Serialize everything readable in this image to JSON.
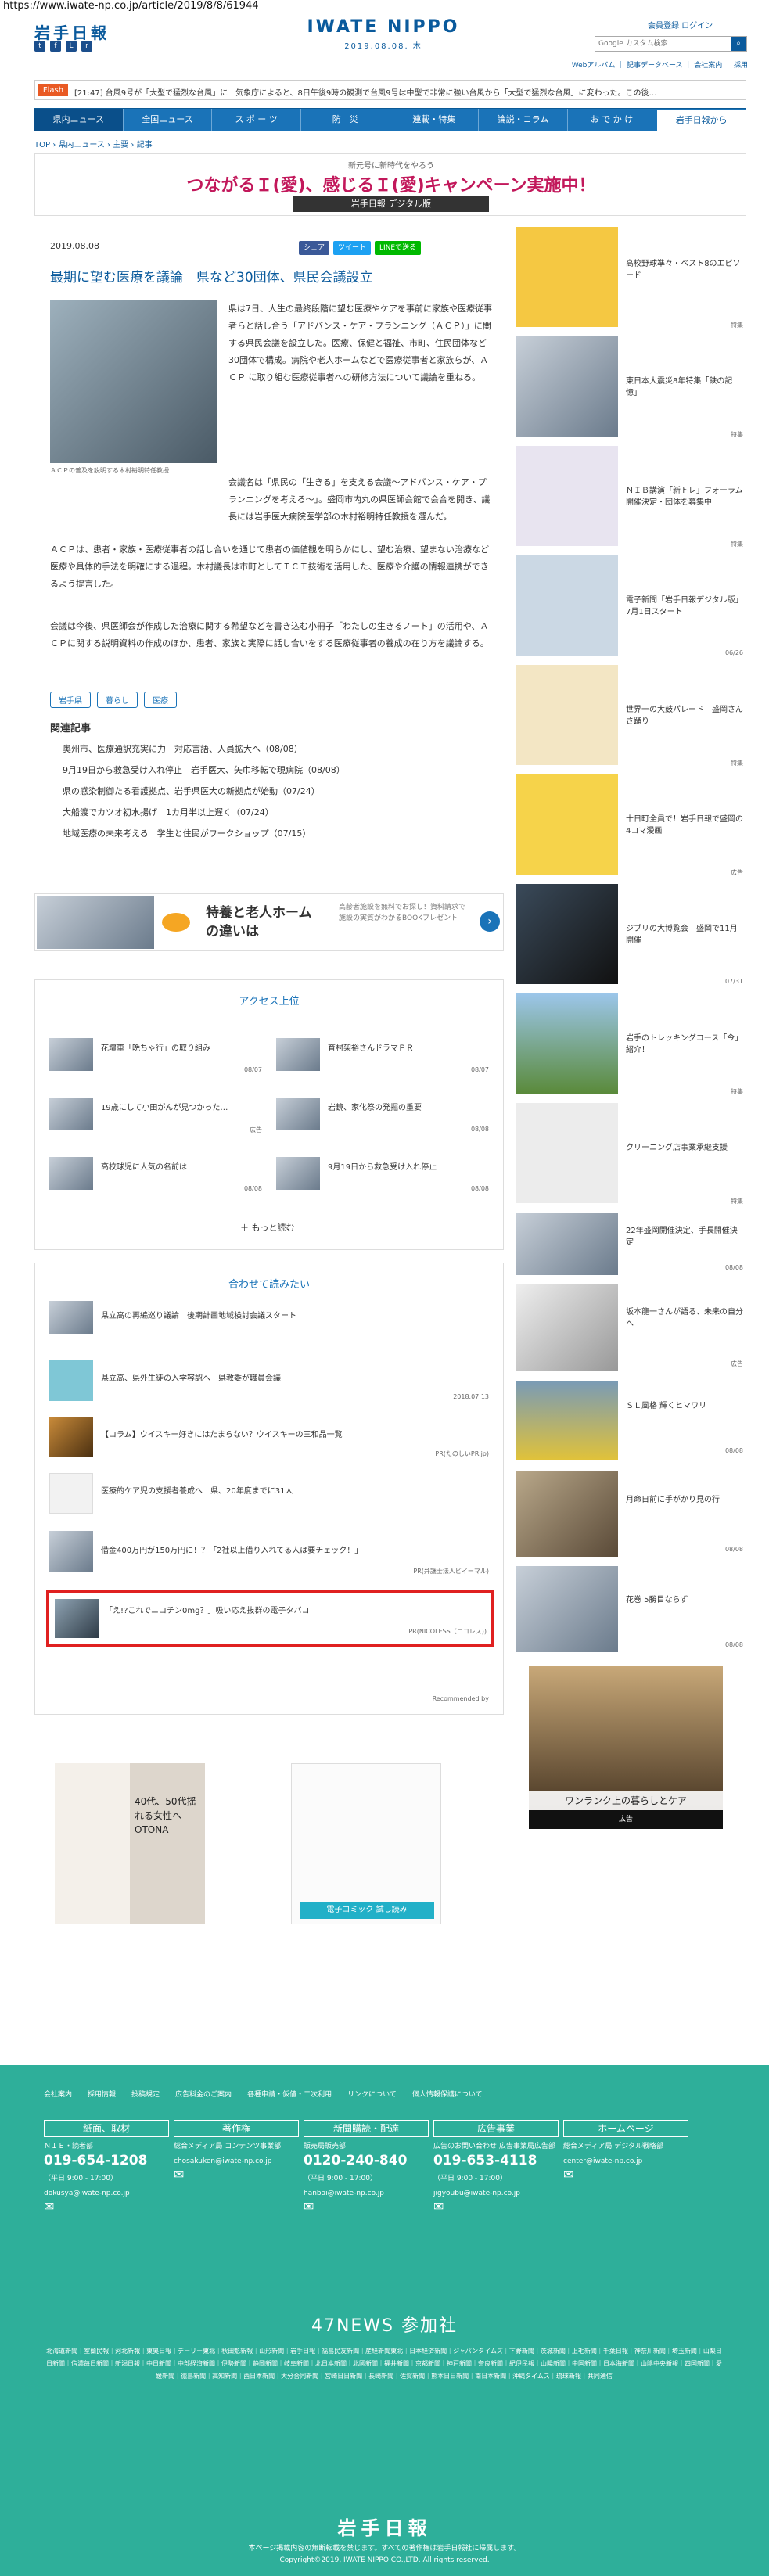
{
  "browser": {
    "url": "https://www.iwate-np.co.jp/article/2019/8/8/61944"
  },
  "header": {
    "logo": "岩手日報",
    "site_name": "IWATE NIPPO",
    "date": "2019.08.08. 木",
    "member_login": "会員登録 ログイン",
    "search_placeholder": "Google カスタム検索",
    "top_links": "Webアルバム ｜ 記事データベース ｜ 会社案内 ｜ 採用"
  },
  "flash": {
    "label": "Flash",
    "text": "[21:47] 台風9号が「大型で猛烈な台風」に　気象庁によると、8日午後9時の観測で台風9号は中型で非常に強い台風から「大型で猛烈な台風」に変わった。この後…"
  },
  "nav": [
    "県内ニュース",
    "全国ニュース",
    "ス ポ ー ツ",
    "防　災",
    "連載・特集",
    "論説・コラム",
    "お で か け",
    "岩手日報から"
  ],
  "breadcrumb": "TOP › 県内ニュース › 主要 › 記事",
  "banner": {
    "sub": "新元号に新時代をやろう",
    "main": "つながるＩ(愛)、感じるＩ(愛)キャンペーン実施中！",
    "foot": "岩手日報 デジタル版"
  },
  "article": {
    "date": "2019.08.08",
    "share": [
      "シェア",
      "ツイート",
      "LINEで送る"
    ],
    "title": "最期に望む医療を議論　県など30団体、県民会議設立",
    "photo_caption": "ＡＣＰの普及を説明する木村裕明特任教授",
    "p1": "県は7日、人生の最終段階に望む医療やケアを事前に家族や医療従事者らと話し合う「アドバンス・ケア・プランニング（ＡＣＰ）」に関する県民会議を設立した。医療、保健と福祉、市町、住民団体など30団体で構成。病院や老人ホームなどで医療従事者と家族らが、Ａ ＣＰ に取り組む医療従事者への研修方法について議論を重ねる。",
    "p2": "会議名は「県民の「生きる」を支える会議～アドバンス・ケア・プランニングを考える～」。盛岡市内丸の県医師会館で会合を開き、議長には岩手医大病院医学部の木村裕明特任教授を選んだ。",
    "p3": "ＡＣＰは、患者・家族・医療従事者の話し合いを通じて患者の価値観を明らかにし、望む治療、望まない治療など医療や具体的手法を明確にする過程。木村議長は市町としてＩＣＴ技術を活用した、医療や介護の情報連携ができるよう提言した。",
    "p4": "会議は今後、県医師会が作成した治療に関する希望などを書き込む小冊子「わたしの生きるノート」の活用や、ＡＣＰに関する説明資料の作成のほか、患者、家族と実際に話し合いをする医療従事者の養成の在り方を議論する。",
    "tags": [
      "岩手県",
      "暮らし",
      "医療"
    ],
    "related_title": "関連記事",
    "related": [
      "奥州市、医療通訳充実に力　対応言語、人員拡大へ（08/08）",
      "9月19日から救急受け入れ停止　岩手医大、矢巾移転で現病院（08/08）",
      "県の感染制御たる看護拠点、岩手県医大の新拠点が始動（07/24）",
      "大船渡でカツオ初水揚げ　1カ月半以上遅く（07/24）",
      "地域医療の未来考える　学生と住民がワークショップ（07/15）"
    ]
  },
  "ad2": {
    "title": "特養と老人ホームの違いは",
    "desc": "高齢者施設を無料でお探し！資料請求で施設の実質がわかるBOOKプレゼント"
  },
  "ranking": {
    "title": "アクセス上位",
    "items": [
      {
        "title": "花壇車「晩ちゃ行」の取り組み",
        "date": "08/07"
      },
      {
        "title": "育村架裕さんドラマＰＲ",
        "date": "08/07"
      },
      {
        "title": "19歳にして小田がんが見つかった…",
        "date": "広告"
      },
      {
        "title": "岩鏡、家化祭の発掘の重要",
        "date": "08/08"
      },
      {
        "title": "高校球児に人気の名前は",
        "date": "08/08"
      },
      {
        "title": "9月19日から救急受け入れ停止",
        "date": "08/08"
      }
    ],
    "more": "もっと読む"
  },
  "recommend": {
    "title": "合わせて読みたい",
    "items": [
      {
        "title": "県立高の再編巡り議論　後期計画地域検討会議スタート",
        "meta": ""
      },
      {
        "title": "県立高、県外生徒の入学容認へ　県教委が職員会議",
        "meta": "2018.07.13"
      },
      {
        "title": "【コラム】ウイスキー好きにはたまらない？ウイスキーの三和品一覧",
        "meta": "PR(たのしいPR.jp)"
      },
      {
        "title": "医療的ケア児の支援者養成へ　県、20年度までに31人",
        "meta": ""
      },
      {
        "title": "借金400万円が150万円に！？「2社以上借り入れてる人は要チェック！」",
        "meta": "PR(弁護士法人ビイーマル)"
      },
      {
        "title": "「え!?これでニコチン0mg？」吸い応え抜群の電子タバコ",
        "meta": "PR(NICOLESS（ニコレス))"
      }
    ],
    "powered": "Recommended by"
  },
  "bottom_ads": [
    {
      "title": "40代、50代揺れる女性へ OTONA"
    },
    {
      "title": "電子コミック 試し読み"
    }
  ],
  "sidebar": [
    {
      "title": "高校野球準々・ベスト8のエピソード",
      "date": "特集"
    },
    {
      "title": "東日本大震災8年特集「鉄の記憶」",
      "date": "特集"
    },
    {
      "title": "ＮＩＢ講演「新トレ」フォーラム開催決定・団体を募集中",
      "date": "特集"
    },
    {
      "title": "電子新聞「岩手日報デジタル版」7月1日スタート",
      "date": "06/26"
    },
    {
      "title": "世界一の大鼓パレード　盛岡さんさ踊り",
      "date": "特集"
    },
    {
      "title": "十日町全員で！岩手日報で盛岡の4コマ漫画",
      "date": "広告"
    },
    {
      "title": "ジブリの大博覧会　盛岡で11月開催",
      "date": "07/31"
    },
    {
      "title": "岩手のトレッキングコース「今」紹介！",
      "date": "特集"
    },
    {
      "title": "クリーニング店事業承継支援",
      "date": "特集"
    },
    {
      "title": "22年盛岡開催決定、手長開催決定",
      "date": "08/08"
    },
    {
      "title": "坂本龍一さんが語る、未来の自分へ",
      "date": "広告"
    },
    {
      "title": "ＳＬ風格 輝くヒマワリ",
      "date": "08/08"
    },
    {
      "title": "月命日前に手がかり見の行",
      "date": "08/08"
    },
    {
      "title": "花巻 5勝目ならず",
      "date": "08/08"
    },
    {
      "title": "ワンランク上の暮らしとケア",
      "date": "広告"
    }
  ],
  "footer": {
    "links": [
      "会社案内",
      "採用情報",
      "投稿規定",
      "広告料金のご案内",
      "各種申請・仮値・二次利用",
      "リンクについて",
      "個人情報保護について"
    ],
    "cols": [
      {
        "head": "紙面、取材",
        "org": "ＮＩＥ・読者部",
        "tel": "019-654-1208",
        "hours": "（平日 9:00 - 17:00）",
        "email": "dokusya@iwate-np.co.jp"
      },
      {
        "head": "著作権",
        "org": "総合メディア局 コンテンツ事業部",
        "tel": "",
        "hours": "",
        "email": "chosakuken@iwate-np.co.jp"
      },
      {
        "head": "新聞購読・配達",
        "org": "販売局販売部",
        "tel": "0120-240-840",
        "hours": "（平日 9:00 - 17:00）",
        "email": "hanbai@iwate-np.co.jp"
      },
      {
        "head": "広告事業",
        "org": "広告のお問い合わせ 広告事業局広告部",
        "tel": "019-653-4118",
        "hours": "（平日 9:00 - 17:00）",
        "email": "jigyoubu@iwate-np.co.jp"
      },
      {
        "head": "ホームページ",
        "org": "総合メディア局 デジタル戦略部",
        "tel": "",
        "hours": "",
        "email": "center@iwate-np.co.jp"
      }
    ],
    "news47_title": "47NEWS 参加社",
    "news47_list": "北海道新聞｜室蘭民報｜河北新報｜東奥日報｜デーリー東北｜秋田魁新報｜山形新聞｜岩手日報｜福島民友新聞｜産経新聞東北｜日本経済新聞｜ジャパンタイムズ｜下野新聞｜茨城新聞｜上毛新聞｜千葉日報｜神奈川新聞｜埼玉新聞｜山梨日日新聞｜信濃毎日新聞｜新潟日報｜中日新聞｜中部経済新聞｜伊勢新聞｜静岡新聞｜岐阜新聞｜北日本新聞｜北國新聞｜福井新聞｜京都新聞｜神戸新聞｜奈良新聞｜紀伊民報｜山陽新聞｜中国新聞｜日本海新聞｜山陰中央新報｜四国新聞｜愛媛新聞｜徳島新聞｜高知新聞｜西日本新聞｜大分合同新聞｜宮崎日日新聞｜長崎新聞｜佐賀新聞｜熊本日日新聞｜南日本新聞｜沖縄タイムス｜琉球新報｜共同通信",
    "logo": "岩手日報",
    "notice": "本ページ掲載内容の無断転載を禁じます。すべての著作権は岩手日報社に帰属します。",
    "copyright": "Copyright©2019, IWATE NIPPO CO.,LTD. All rights reserved."
  },
  "colors": {
    "brand": "#1a73b8",
    "footer": "#2eaf9a",
    "highlight": "#e02020",
    "flash": "#e95a24"
  }
}
